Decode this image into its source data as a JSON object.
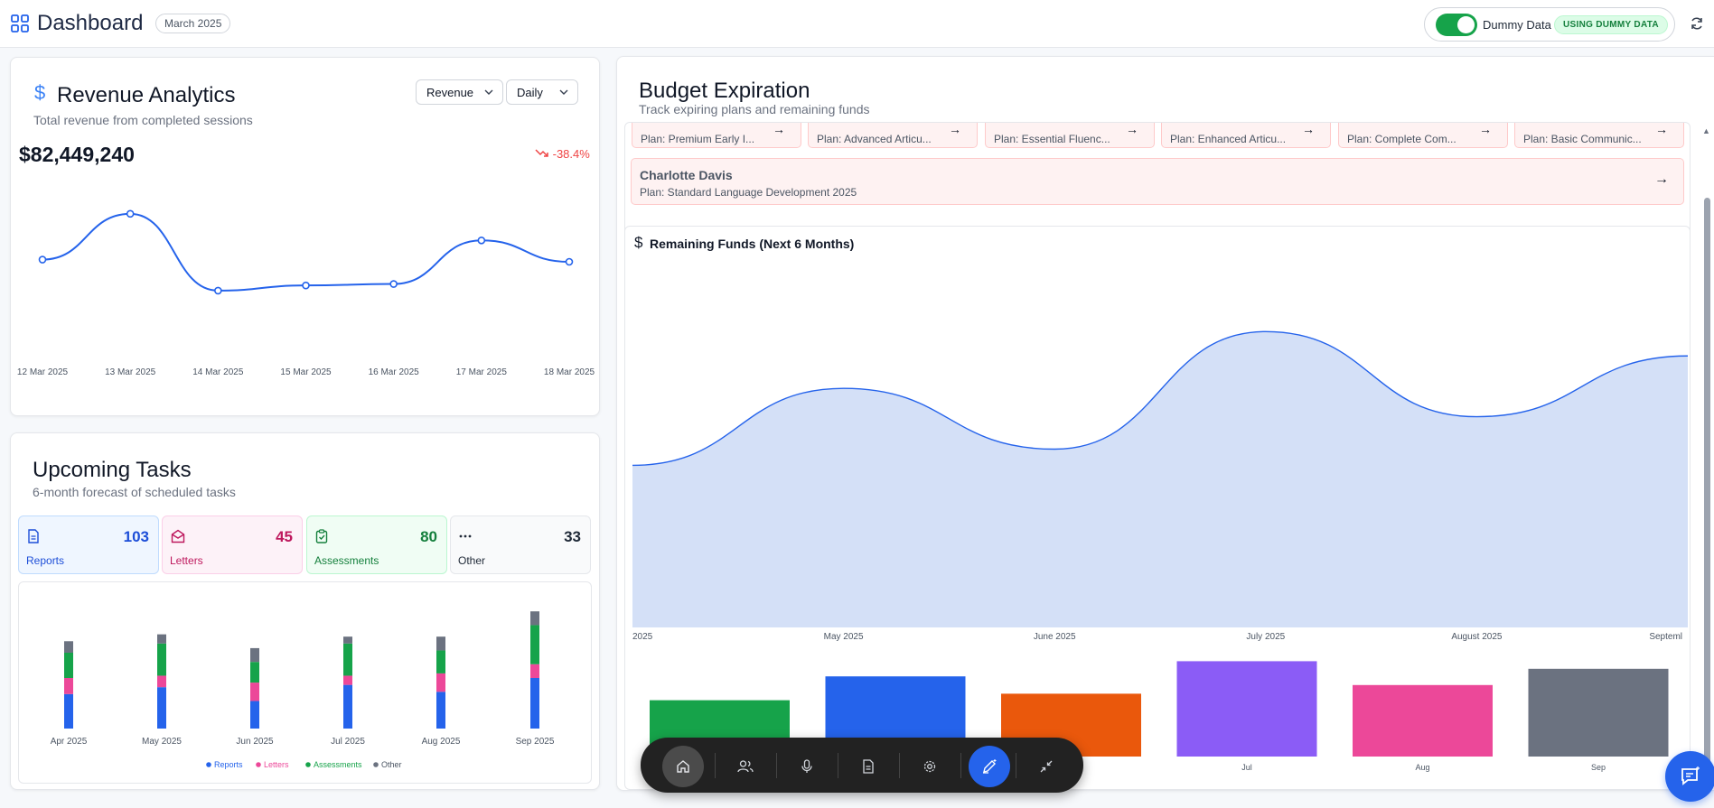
{
  "header": {
    "title": "Dashboard",
    "month": "March 2025",
    "toggle_label": "Dummy Data",
    "dummy_badge": "USING DUMMY DATA"
  },
  "revenue": {
    "title": "Revenue Analytics",
    "subtitle": "Total revenue from completed sessions",
    "metric_select": "Revenue",
    "period_select": "Daily",
    "total": "$82,449,240",
    "change": "-38.4%",
    "chart_data": {
      "type": "line",
      "x": [
        "12 Mar 2025",
        "13 Mar 2025",
        "14 Mar 2025",
        "15 Mar 2025",
        "16 Mar 2025",
        "17 Mar 2025",
        "18 Mar 2025"
      ],
      "values": [
        12.4,
        18.6,
        8.2,
        8.9,
        9.1,
        15.0,
        12.1
      ],
      "ylim": [
        0,
        22
      ],
      "color": "#2563eb"
    }
  },
  "tasks": {
    "title": "Upcoming Tasks",
    "subtitle": "6-month forecast of scheduled tasks",
    "stats": [
      {
        "label": "Reports",
        "value": "103"
      },
      {
        "label": "Letters",
        "value": "45"
      },
      {
        "label": "Assessments",
        "value": "80"
      },
      {
        "label": "Other",
        "value": "33"
      }
    ],
    "chart_data": {
      "type": "bar",
      "stacked": true,
      "categories": [
        "Apr 2025",
        "May 2025",
        "Jun 2025",
        "Jul 2025",
        "Aug 2025",
        "Sep 2025"
      ],
      "series": [
        {
          "name": "Reports",
          "values": [
            15,
            18,
            12,
            19,
            16,
            22
          ],
          "color": "#2563eb"
        },
        {
          "name": "Letters",
          "values": [
            7,
            5,
            8,
            4,
            8,
            6
          ],
          "color": "#ec4899"
        },
        {
          "name": "Assessments",
          "values": [
            11,
            14,
            9,
            14,
            10,
            17
          ],
          "color": "#16a34a"
        },
        {
          "name": "Other",
          "values": [
            5,
            4,
            6,
            3,
            6,
            6
          ],
          "color": "#6b7280"
        }
      ],
      "ylim": [
        0,
        55
      ]
    }
  },
  "budget": {
    "title": "Budget Expiration",
    "subtitle": "Track expiring plans and remaining funds",
    "plan_chips": [
      "Plan: Premium Early I...",
      "Plan: Advanced Articu...",
      "Plan: Essential Fluenc...",
      "Plan: Enhanced Articu...",
      "Plan: Complete Com...",
      "Plan: Basic Communic..."
    ],
    "expiring": {
      "name": "Charlotte Davis",
      "plan": "Plan: Standard Language Development 2025"
    },
    "funds_title": "Remaining Funds (Next 6 Months)",
    "funds_chart": {
      "type": "area",
      "x": [
        "2025",
        "May 2025",
        "June 2025",
        "July 2025",
        "August 2025",
        "Septeml"
      ],
      "values": [
        40,
        59,
        44,
        73,
        52,
        67
      ],
      "ylim": [
        0,
        90
      ],
      "color": "#2563eb",
      "fill": "#d4e0f7"
    },
    "bars_chart": {
      "type": "bar",
      "categories": [
        "",
        "",
        "",
        "Jul",
        "Aug",
        "Sep"
      ],
      "values": [
        52,
        74,
        58,
        88,
        66,
        81
      ],
      "ylim": [
        0,
        100
      ],
      "colors": [
        "#16a34a",
        "#2563eb",
        "#ea580c",
        "#8b5cf6",
        "#ec4899",
        "#6b7280"
      ]
    }
  },
  "icons": {
    "logo": "layout-grid-icon",
    "refresh": "refresh-icon",
    "toolbar": [
      "home-icon",
      "users-icon",
      "microphone-icon",
      "document-icon",
      "settings-icon",
      "pen-sparkle-icon",
      "collapse-icon"
    ],
    "chat": "chat-icon"
  }
}
